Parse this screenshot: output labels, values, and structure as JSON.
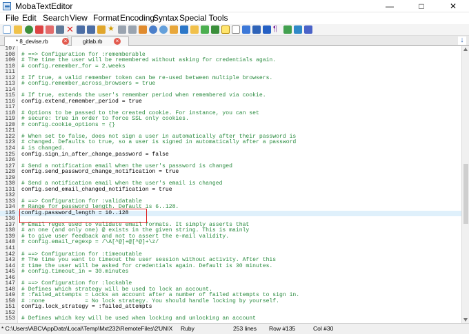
{
  "window": {
    "title": "MobaTextEditor",
    "buttons": [
      "—",
      "□",
      "✕"
    ]
  },
  "menu": [
    "File",
    "Edit",
    "Search",
    "View",
    "Format",
    "Encoding",
    "Syntax",
    "Special Tools"
  ],
  "toolbar_icons": [
    "new-file-icon",
    "open-folder-icon",
    "save-icon",
    "save-all-icon",
    "calendar-icon",
    "print-icon",
    "delete-icon",
    "outdent-icon",
    "indent-icon",
    "bookmark-icon",
    "star-icon",
    "cut-icon",
    "copy-icon",
    "paste-icon",
    "find-icon",
    "find-next-icon",
    "replace-icon",
    "goto-icon",
    "undo-icon",
    "redo-icon",
    "settings-icon",
    "highlight-icon",
    "bold-icon",
    "back-icon",
    "forward-icon",
    "wrap-icon",
    "paragraph-icon",
    "pencil-icon",
    "puzzle-icon",
    "close-icon"
  ],
  "tabs": [
    {
      "label": "* 8_devise.rb",
      "active": true
    },
    {
      "label": "gitlab.rb",
      "active": false
    }
  ],
  "editor": {
    "current_line": 135,
    "lines": [
      {
        "n": "107",
        "code": "",
        "comment": false
      },
      {
        "n": "108",
        "code": "# ==> Configuration for :rememberable",
        "comment": true
      },
      {
        "n": "109",
        "code": "# The time the user will be remembered without asking for credentials again.",
        "comment": true
      },
      {
        "n": "110",
        "code": "# config.remember_for = 2.weeks",
        "comment": true
      },
      {
        "n": "111",
        "code": "",
        "comment": false
      },
      {
        "n": "112",
        "code": "# If true, a valid remember token can be re-used between multiple browsers.",
        "comment": true
      },
      {
        "n": "113",
        "code": "# config.remember_across_browsers = true",
        "comment": true
      },
      {
        "n": "114",
        "code": "",
        "comment": false
      },
      {
        "n": "115",
        "code": "# If true, extends the user's remember period when remembered via cookie.",
        "comment": true
      },
      {
        "n": "116",
        "code": "config.extend_remember_period = true",
        "comment": false
      },
      {
        "n": "117",
        "code": "",
        "comment": false
      },
      {
        "n": "118",
        "code": "# Options to be passed to the created cookie. For instance, you can set",
        "comment": true
      },
      {
        "n": "119",
        "code": "# secure: true in order to force SSL only cookies.",
        "comment": true
      },
      {
        "n": "120",
        "code": "# config.cookie_options = {}",
        "comment": true
      },
      {
        "n": "121",
        "code": "",
        "comment": false
      },
      {
        "n": "122",
        "code": "# When set to false, does not sign a user in automatically after their password is",
        "comment": true
      },
      {
        "n": "123",
        "code": "# changed. Defaults to true, so a user is signed in automatically after a password",
        "comment": true
      },
      {
        "n": "124",
        "code": "# is changed.",
        "comment": true
      },
      {
        "n": "125",
        "code": "config.sign_in_after_change_password = false",
        "comment": false
      },
      {
        "n": "126",
        "code": "",
        "comment": false
      },
      {
        "n": "127",
        "code": "# Send a notification email when the user's password is changed",
        "comment": true
      },
      {
        "n": "128",
        "code": "config.send_password_change_notification = true",
        "comment": false
      },
      {
        "n": "129",
        "code": "",
        "comment": false
      },
      {
        "n": "130",
        "code": "# Send a notification email when the user's email is changed",
        "comment": true
      },
      {
        "n": "131",
        "code": "config.send_email_changed_notification = true",
        "comment": false
      },
      {
        "n": "132",
        "code": "",
        "comment": false
      },
      {
        "n": "133",
        "code": "# ==> Configuration for :validatable",
        "comment": true
      },
      {
        "n": "134",
        "code": "# Range for password length. Default is 6..128.",
        "comment": true
      },
      {
        "n": "135",
        "code": "config.password_length = 10..128",
        "comment": false
      },
      {
        "n": "136",
        "code": "",
        "comment": false
      },
      {
        "n": "137",
        "code": "# Email regex used to validate email formats. It simply asserts that",
        "comment": true
      },
      {
        "n": "138",
        "code": "# an one (and only one) @ exists in the given string. This is mainly",
        "comment": true
      },
      {
        "n": "139",
        "code": "# to give user feedback and not to assert the e-mail validity.",
        "comment": true
      },
      {
        "n": "140",
        "code": "# config.email_regexp = /\\A[^@]+@[^@]+\\z/",
        "comment": true
      },
      {
        "n": "141",
        "code": "",
        "comment": false
      },
      {
        "n": "142",
        "code": "# ==> Configuration for :timeoutable",
        "comment": true
      },
      {
        "n": "143",
        "code": "# The time you want to timeout the user session without activity. After this",
        "comment": true
      },
      {
        "n": "144",
        "code": "# time the user will be asked for credentials again. Default is 30 minutes.",
        "comment": true
      },
      {
        "n": "145",
        "code": "# config.timeout_in = 30.minutes",
        "comment": true
      },
      {
        "n": "146",
        "code": "",
        "comment": false
      },
      {
        "n": "147",
        "code": "# ==> Configuration for :lockable",
        "comment": true
      },
      {
        "n": "148",
        "code": "# Defines which strategy will be used to lock an account.",
        "comment": true
      },
      {
        "n": "149",
        "code": "# :failed_attempts = Locks an account after a number of failed attempts to sign in.",
        "comment": true
      },
      {
        "n": "150",
        "code": "# :none            = No lock strategy. You should handle locking by yourself.",
        "comment": true
      },
      {
        "n": "151",
        "code": "config.lock_strategy = :failed_attempts",
        "comment": false
      },
      {
        "n": "152",
        "code": "",
        "comment": false
      },
      {
        "n": "153",
        "code": "# Defines which key will be used when locking and unlocking an account",
        "comment": true
      }
    ]
  },
  "statusbar": {
    "path": "* C:\\Users\\ABC\\AppData\\Local\\Temp\\Mxt232\\RemoteFiles\\2'",
    "line_ending": "UNIX",
    "language": "Ruby",
    "lines": "253 lines",
    "row": "Row #135",
    "col": "Col #30"
  },
  "colors": {
    "comment": "#2a8b3f",
    "current_line": "#dff0fb",
    "highlight_box": "#dd2222"
  }
}
